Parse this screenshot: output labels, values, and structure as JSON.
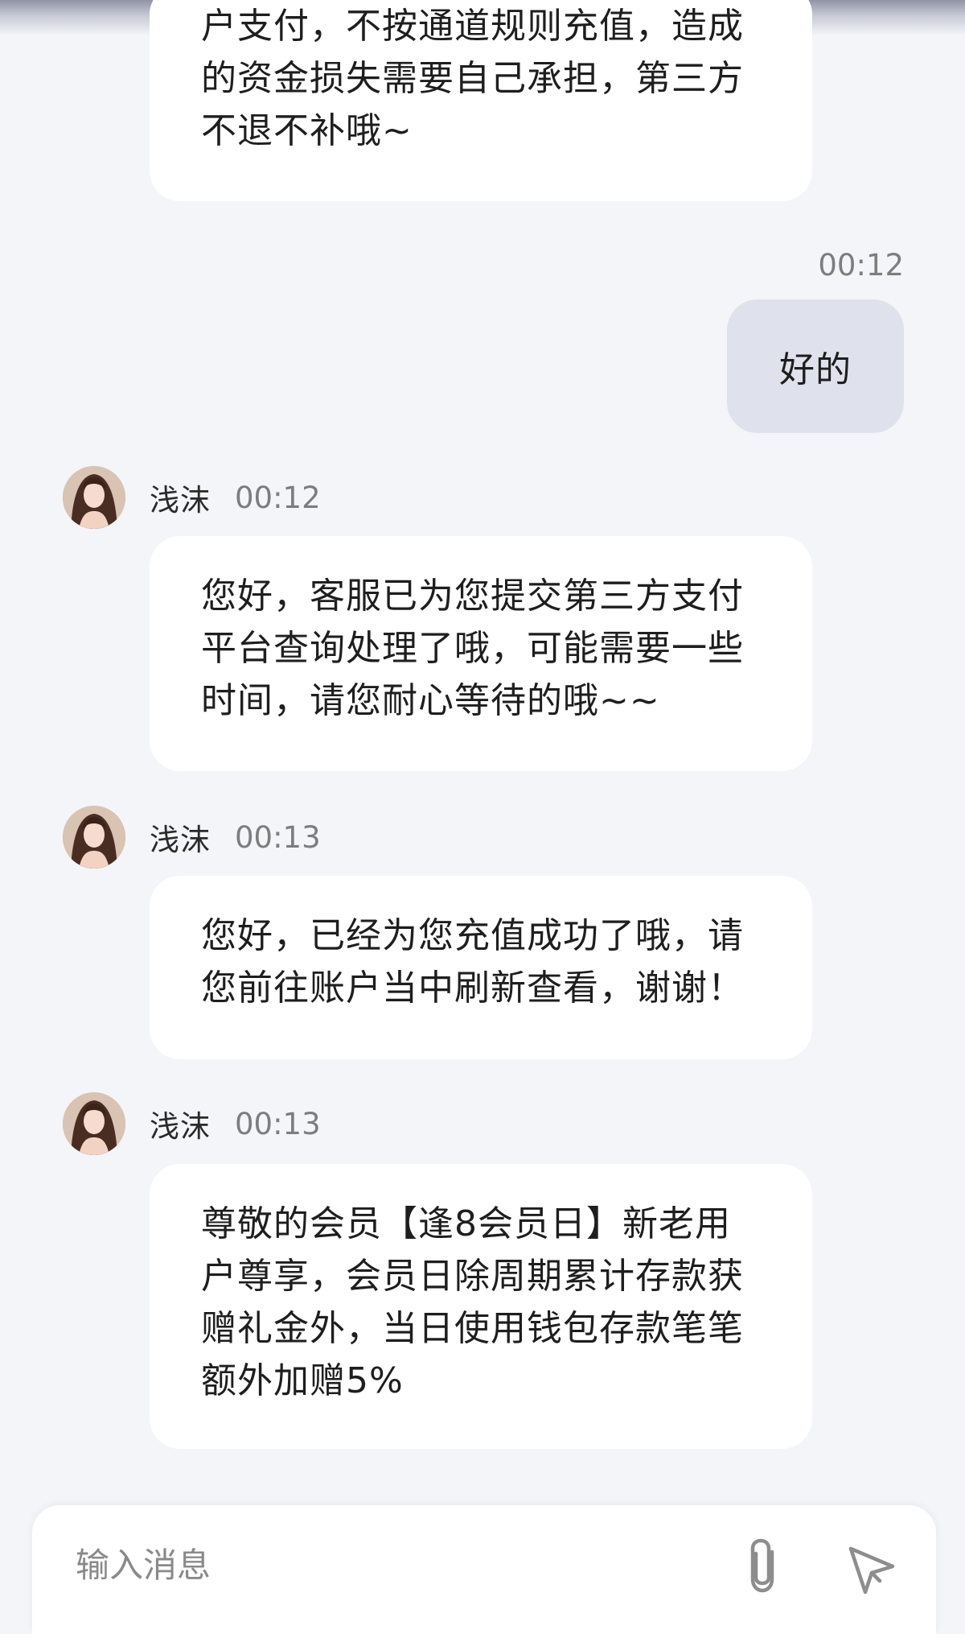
{
  "messages": [
    {
      "lines": [
        "户支付，不按通道规则充值，造成",
        "的资金损失需要自己承担，第三方",
        "不退不补哦~"
      ]
    },
    {
      "time": "00:12",
      "text": "好的"
    },
    {
      "sender": "浅沫",
      "time": "00:12",
      "lines": [
        "您好，客服已为您提交第三方支付",
        "平台查询处理了哦，可能需要一些",
        "时间，请您耐心等待的哦~~"
      ]
    },
    {
      "sender": "浅沫",
      "time": "00:13",
      "lines": [
        "您好，已经为您充值成功了哦，请",
        "您前往账户当中刷新查看，谢谢！"
      ]
    },
    {
      "sender": "浅沫",
      "time": "00:13",
      "lines": [
        "尊敬的会员【逢8会员日】新老用",
        "户尊享，会员日除周期累计存款获",
        "赠礼金外，当日使用钱包存款笔笔",
        "额外加赠5%"
      ]
    }
  ],
  "input": {
    "placeholder": "输入消息",
    "attach_icon": "paperclip-icon",
    "send_icon": "send-icon"
  }
}
